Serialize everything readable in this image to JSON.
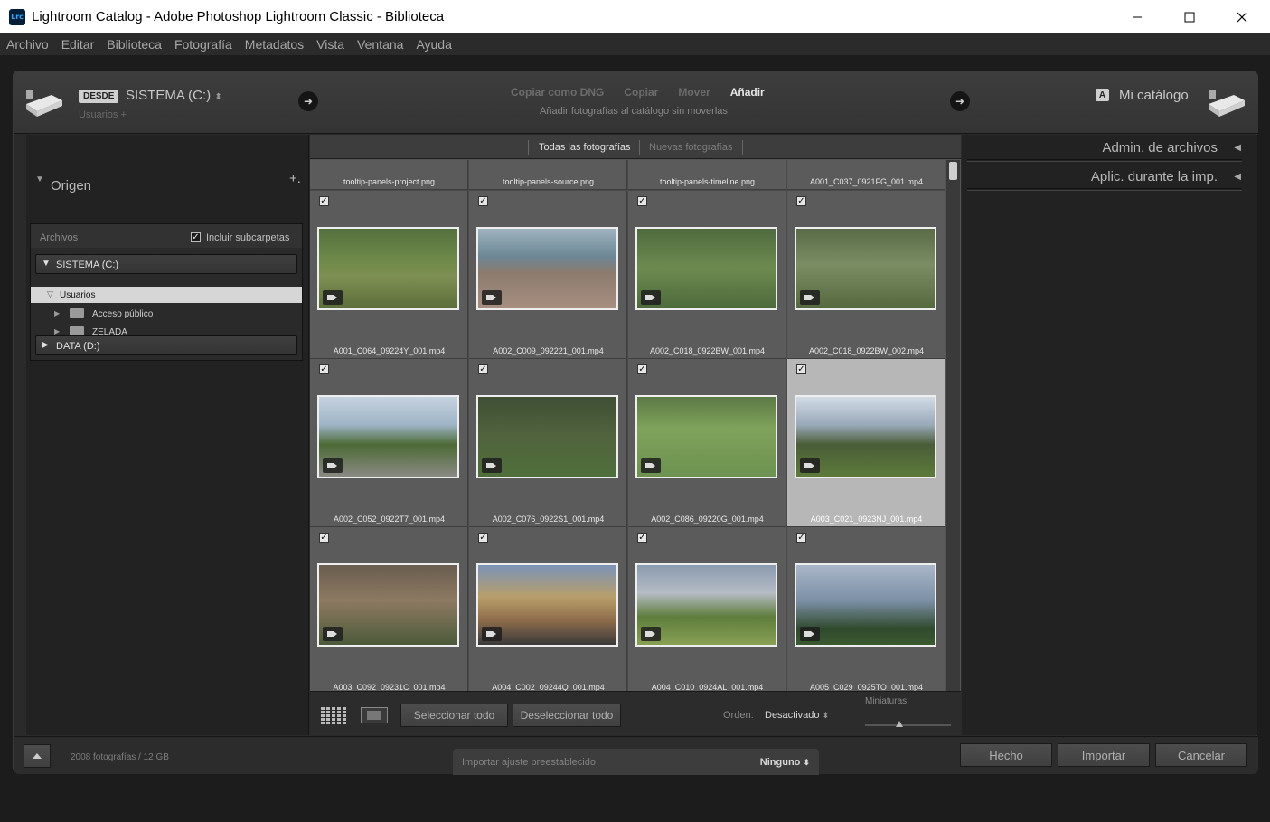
{
  "window": {
    "app_icon": "Lrc",
    "title": "Lightroom Catalog - Adobe Photoshop Lightroom Classic - Biblioteca",
    "minimize_icon": "minimize-icon",
    "maximize_icon": "maximize-icon",
    "close_icon": "close-icon"
  },
  "menu": [
    "Archivo",
    "Editar",
    "Biblioteca",
    "Fotografía",
    "Metadatos",
    "Vista",
    "Ventana",
    "Ayuda"
  ],
  "header": {
    "from_badge": "DESDE",
    "source_name": "SISTEMA (C:)",
    "source_path": "Usuarios +",
    "modes": [
      "Copiar como DNG",
      "Copiar",
      "Mover",
      "Añadir"
    ],
    "active_mode": "Añadir",
    "mode_description": "Añadir fotografías al catálogo sin moverlas",
    "dest_badge": "A",
    "dest_name": "Mi catálogo"
  },
  "left_panel": {
    "title": "Origen",
    "plus": "+.",
    "files_label": "Archivos",
    "include_subfolders": "Incluir subcarpetas",
    "include_subfolders_checked": true,
    "volumes": [
      "SISTEMA (C:)",
      "DATA (D:)"
    ],
    "selected_folder": "Usuarios",
    "folders": [
      "Acceso público",
      "ZELADA"
    ]
  },
  "grid": {
    "tab_all": "Todas las fotografías",
    "tab_new": "Nuevas fotografías",
    "top_row_names": [
      "tooltip-panels-project.png",
      "tooltip-panels-source.png",
      "tooltip-panels-timeline.png",
      "A001_C037_0921FG_001.mp4"
    ],
    "items": [
      {
        "name": "A001_C064_09224Y_001.mp4",
        "checked": true,
        "selected": false
      },
      {
        "name": "A002_C009_092221_001.mp4",
        "checked": true,
        "selected": false
      },
      {
        "name": "A002_C018_0922BW_001.mp4",
        "checked": true,
        "selected": false
      },
      {
        "name": "A002_C018_0922BW_002.mp4",
        "checked": true,
        "selected": false
      },
      {
        "name": "A002_C052_0922T7_001.mp4",
        "checked": true,
        "selected": false
      },
      {
        "name": "A002_C076_0922S1_001.mp4",
        "checked": true,
        "selected": false
      },
      {
        "name": "A002_C086_09220G_001.mp4",
        "checked": true,
        "selected": false
      },
      {
        "name": "A003_C021_0923NJ_001.mp4",
        "checked": true,
        "selected": true
      },
      {
        "name": "A003_C092_09231C_001.mp4",
        "checked": true,
        "selected": false
      },
      {
        "name": "A004_C002_09244Q_001.mp4",
        "checked": true,
        "selected": false
      },
      {
        "name": "A004_C010_0924AL_001.mp4",
        "checked": true,
        "selected": false
      },
      {
        "name": "A005_C029_0925TO_001.mp4",
        "checked": true,
        "selected": false
      }
    ],
    "select_all": "Seleccionar todo",
    "deselect_all": "Deseleccionar todo",
    "sort_label": "Orden:",
    "sort_value": "Desactivado",
    "thumbs_label": "Miniaturas",
    "thumbs_size": 0.4
  },
  "right_panel": {
    "file_handling": "Admin. de archivos",
    "apply_during_import": "Aplic. durante la imp."
  },
  "footer": {
    "count": "2008 fotografías / 12 GB",
    "preset_label": "Importar ajuste preestablecido:",
    "preset_value": "Ninguno",
    "done": "Hecho",
    "import": "Importar",
    "cancel": "Cancelar"
  }
}
